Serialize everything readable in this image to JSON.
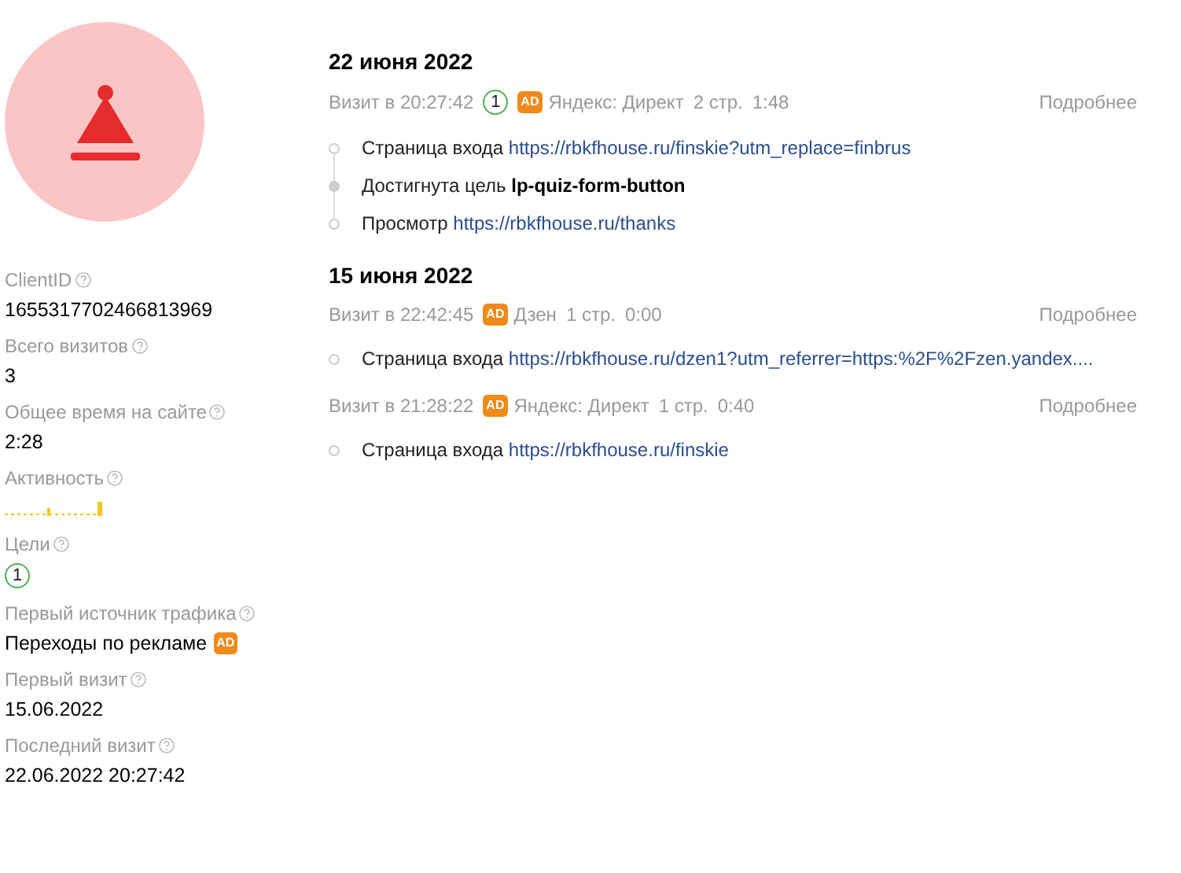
{
  "profile": {
    "fields": [
      {
        "kind": "text",
        "label": "ClientID",
        "value": "1655317702466813969"
      },
      {
        "kind": "text",
        "label": "Всего визитов",
        "value": "3"
      },
      {
        "kind": "text",
        "label": "Общее время на сайте",
        "value": "2:28"
      },
      {
        "kind": "activity",
        "label": "Активность"
      },
      {
        "kind": "goals",
        "label": "Цели",
        "value": "1"
      },
      {
        "kind": "ad",
        "label": "Первый источник трафика",
        "value": "Переходы по рекламе",
        "badge": "AD"
      },
      {
        "kind": "text",
        "label": "Первый визит",
        "value": "15.06.2022"
      },
      {
        "kind": "text",
        "label": "Последний визит",
        "value": "22.06.2022 20:27:42"
      }
    ]
  },
  "days": [
    {
      "date": "22 июня 2022",
      "visits": [
        {
          "time": "Визит в 20:27:42",
          "goals": "1",
          "badge": "AD",
          "source": "Яндекс: Директ",
          "pages": "2 стр.",
          "duration": "1:48",
          "more": "Подробнее",
          "events": [
            {
              "kind": "entry",
              "label": "Страница входа",
              "value": "https://rbkfhouse.ru/finskie?utm_replace=finbrus"
            },
            {
              "kind": "goal",
              "label": "Достигнута цель",
              "value": "lp-quiz-form-button"
            },
            {
              "kind": "view",
              "label": "Просмотр",
              "value": "https://rbkfhouse.ru/thanks"
            }
          ]
        }
      ]
    },
    {
      "date": "15 июня 2022",
      "visits": [
        {
          "time": "Визит в 22:42:45",
          "badge": "AD",
          "source": "Дзен",
          "pages": "1 стр.",
          "duration": "0:00",
          "more": "Подробнее",
          "events": [
            {
              "kind": "entry",
              "label": "Страница входа",
              "value": "https://rbkfhouse.ru/dzen1?utm_referrer=https:%2F%2Fzen.yandex...."
            }
          ]
        },
        {
          "time": "Визит в 21:28:22",
          "badge": "AD",
          "source": "Яндекс: Директ",
          "pages": "1 стр.",
          "duration": "0:40",
          "more": "Подробнее",
          "events": [
            {
              "kind": "entry",
              "label": "Страница входа",
              "value": "https://rbkfhouse.ru/finskie"
            }
          ]
        }
      ]
    }
  ]
}
